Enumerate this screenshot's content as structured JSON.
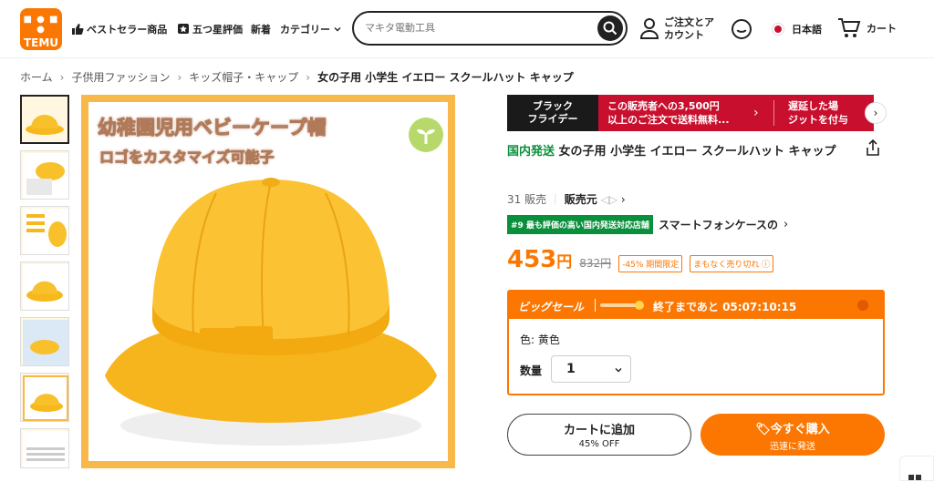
{
  "header": {
    "logo_top": "■ ● ■ ●",
    "logo_name": "TEMU",
    "nav": [
      "ベストセラー商品",
      "五つ星評価",
      "新着",
      "カテゴリー"
    ],
    "search_placeholder": "マキタ電動工具",
    "orders_line1": "ご注文とア",
    "orders_line2": "カウント",
    "language": "日本語",
    "cart": "カート"
  },
  "breadcrumb": [
    "ホーム",
    "子供用ファッション",
    "キッズ帽子・キャップ",
    "女の子用 小学生 イエロー スクールハット キャップ"
  ],
  "main_image": {
    "title": "幼稚園児用ベビーケープ帽",
    "subtitle": "ロゴをカスタマイズ可能子"
  },
  "banner": {
    "tag_line1": "ブラック",
    "tag_line2": "フライデー",
    "promo1_line1": "この販売者への3,500円",
    "promo1_line2": "以上のご注文で送料無料...",
    "promo2_line1": "遅延した場",
    "promo2_line2": "ジットを付与"
  },
  "product": {
    "domestic": "国内発送",
    "title": "女の子用 小学生 イエロー スクールハット キャップ",
    "sold": "31 販売",
    "seller": "販売元",
    "rank_badge": "#9 最も評価の高い国内発送対応店舗",
    "rank_category": "スマートフォンケースの",
    "price": "453",
    "currency": "円",
    "original_price": "832円",
    "discount": "-45% 期間限定",
    "selling_fast": "まもなく売り切れ"
  },
  "big_sale": {
    "label": "ビッグセール",
    "countdown_prefix": "終了まであと",
    "countdown": "05:07:10:15",
    "color": "色: 黄色",
    "qty_label": "数量",
    "qty_value": "1"
  },
  "buttons": {
    "cart": "カートに追加",
    "cart_sub": "45% OFF",
    "buy": "今すぐ購入",
    "buy_sub": "迅速に発送"
  },
  "colors": {
    "brand": "#fb7701",
    "promo_red": "#c8102e",
    "green": "#0a8f3c"
  }
}
